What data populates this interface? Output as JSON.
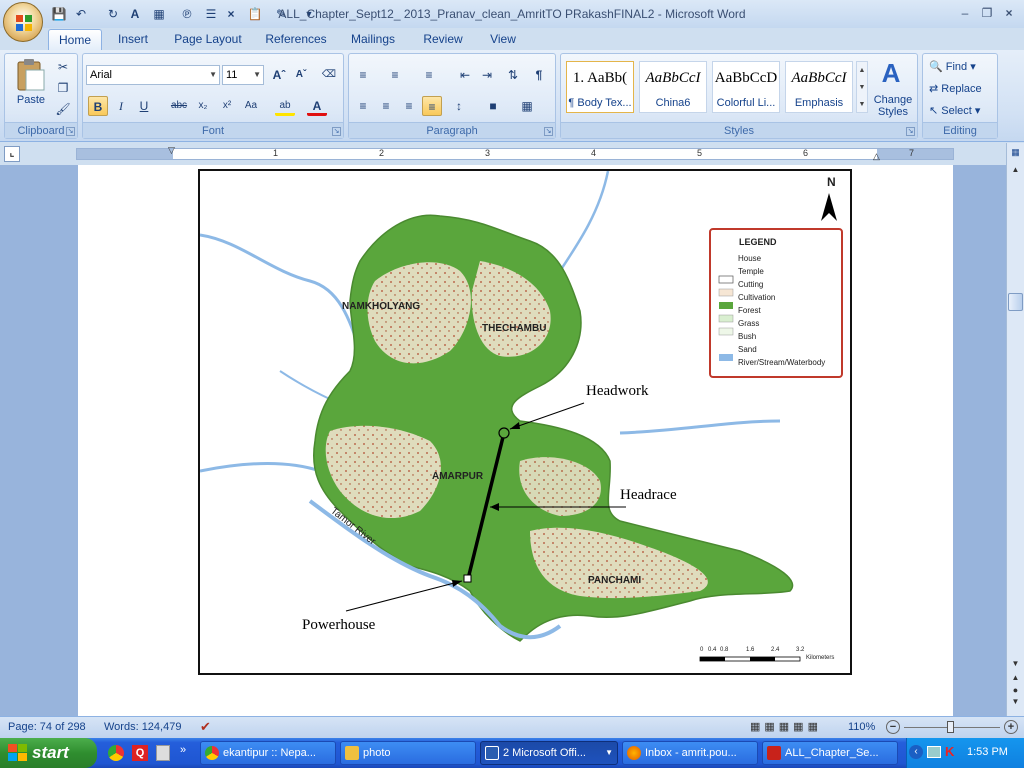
{
  "window": {
    "title": "ALL_Chapter_Sept12_ 2013_Pranav_clean_AmritTO PRakashFINAL2 - Microsoft Word"
  },
  "tabs": [
    "Home",
    "Insert",
    "Page Layout",
    "References",
    "Mailings",
    "Review",
    "View"
  ],
  "ribbon": {
    "clipboard": {
      "label": "Clipboard",
      "paste": "Paste"
    },
    "font": {
      "label": "Font",
      "name": "Arial",
      "size": "11"
    },
    "paragraph": {
      "label": "Paragraph"
    },
    "styles": {
      "label": "Styles",
      "items": [
        {
          "preview": "1.  AaBb(",
          "name": "¶ Body Tex..."
        },
        {
          "preview": "AaBbCcI",
          "name": "China6"
        },
        {
          "preview": "AaBbCcD",
          "name": "Colorful Li..."
        },
        {
          "preview": "AaBbCcI",
          "name": "Emphasis"
        }
      ],
      "change_styles": [
        "Change",
        "Styles"
      ]
    },
    "editing": {
      "label": "Editing",
      "find": "Find",
      "replace": "Replace",
      "select": "Select"
    }
  },
  "ruler": {
    "numbers": [
      "1",
      "2",
      "3",
      "4",
      "5",
      "6",
      "7"
    ]
  },
  "map": {
    "north": "N",
    "legend": {
      "title": "LEGEND",
      "items": [
        "House",
        "Temple",
        "Cutting",
        "Cultivation",
        "Forest",
        "Grass",
        "Bush",
        "Sand",
        "River/Stream/Waterbody"
      ]
    },
    "regions": [
      "NAMKHOLYANG",
      "THECHAMBU",
      "AMARPUR",
      "PANCHAMI"
    ],
    "river": "Tamor River",
    "callouts": {
      "headwork": "Headwork",
      "headrace": "Headrace",
      "powerhouse": "Powerhouse"
    },
    "scale": {
      "ticks": [
        "0",
        "0.4",
        "0.8",
        "1.6",
        "2.4",
        "3.2"
      ],
      "unit": "Kilometers"
    }
  },
  "status": {
    "page": "Page: 74 of 298",
    "words": "Words: 124,479",
    "zoom": "110%"
  },
  "taskbar": {
    "start": "start",
    "items": [
      "ekantipur :: Nepa...",
      "photo",
      "2 Microsoft Offi...",
      "Inbox - amrit.pou...",
      "ALL_Chapter_Se..."
    ],
    "clock": "1:53 PM"
  },
  "colors": {
    "forest": "#5aa63c",
    "cultivation": "#f6e6d4",
    "water": "#8db9e6",
    "accent": "#245edb"
  }
}
